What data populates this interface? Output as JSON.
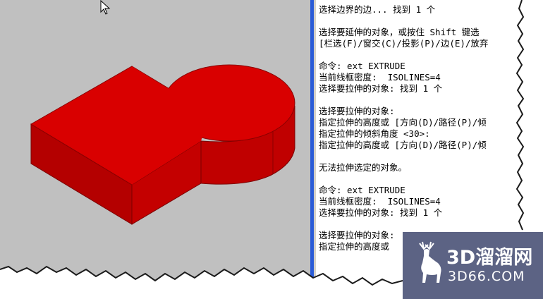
{
  "command_window": {
    "lines": [
      "选择边界的边... 找到 1 个",
      "",
      "选择要延伸的对象，或按住 Shift 键选",
      "[栏选(F)/窗交(C)/投影(P)/边(E)/放弃",
      "",
      "命令: ext EXTRUDE",
      "当前线框密度:  ISOLINES=4",
      "选择要拉伸的对象: 找到 1 个",
      "",
      "选择要拉伸的对象:",
      "指定拉伸的高度或 [方向(D)/路径(P)/倾",
      "指定拉伸的倾斜角度 <30>:",
      "指定拉伸的高度或 [方向(D)/路径(P)/倾",
      "",
      "无法拉伸选定的对象。",
      "",
      "命令: ext EXTRUDE",
      "当前线框密度:  ISOLINES=4",
      "选择要拉伸的对象: 找到 1 个",
      "",
      "选择要拉伸的对象:",
      "指定拉伸的高度或"
    ]
  },
  "watermark": {
    "name": "3D溜溜网",
    "url": "3D66.COM",
    "icon": "deer-logo-icon"
  },
  "colors": {
    "viewport_bg": "#c0c0c0",
    "solid_top": "#d90000",
    "solid_front": "#b40000",
    "solid_side": "#c80000",
    "splitter": "#2a5bd7",
    "watermark_bg": "#4e567a"
  }
}
